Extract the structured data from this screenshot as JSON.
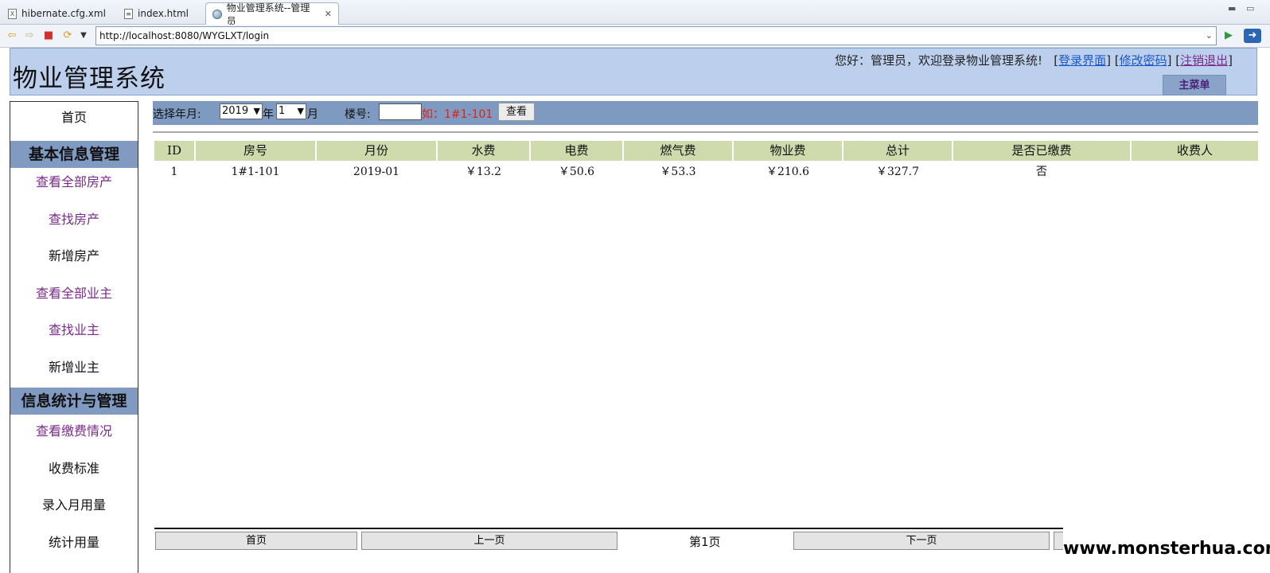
{
  "tabs": [
    {
      "label": "hibernate.cfg.xml"
    },
    {
      "label": "index.html"
    },
    {
      "label": "物业管理系统--管理员"
    }
  ],
  "tab_close": "✕",
  "browser": {
    "url": "http://localhost:8080/WYGLXT/login"
  },
  "header": {
    "title": "物业管理系统",
    "greeting": "您好：管理员，欢迎登录物业管理系统!",
    "links": [
      "登录界面",
      "修改密码",
      "注销退出"
    ],
    "main_menu": "主菜单"
  },
  "sidebar": {
    "home": "首页",
    "section1": "基本信息管理",
    "items1": [
      "查看全部房产",
      "查找房产",
      "新增房产",
      "查看全部业主",
      "查找业主",
      "新增业主"
    ],
    "section2": "信息统计与管理",
    "items2": [
      "查看缴费情况",
      "收费标准",
      "录入月用量",
      "统计用量"
    ]
  },
  "query": {
    "label_year_month": "选择年月:",
    "year": "2019",
    "year_unit": "年",
    "month": "1",
    "month_unit": "月",
    "label_building": "楼号:",
    "building_value": "",
    "hint": "如：1#1-101",
    "button": "查看"
  },
  "table": {
    "columns": [
      "ID",
      "房号",
      "月份",
      "水费",
      "电费",
      "燃气费",
      "物业费",
      "总计",
      "是否已缴费",
      "收费人"
    ],
    "rows": [
      [
        "1",
        "1#1-101",
        "2019-01",
        "￥13.2",
        "￥50.6",
        "￥53.3",
        "￥210.6",
        "￥327.7",
        "否",
        ""
      ]
    ]
  },
  "pager": {
    "first": "首页",
    "prev": "上一页",
    "current": "第1页",
    "next": "下一页"
  },
  "watermark": "www.monsterhua.com",
  "colors": {
    "header_bg": "#bcd0ee",
    "sidebar_head_bg": "#819ac2",
    "table_head_bg": "#cfdbad",
    "hint_red": "#e0201a",
    "visited_link": "#7a2a8a"
  }
}
